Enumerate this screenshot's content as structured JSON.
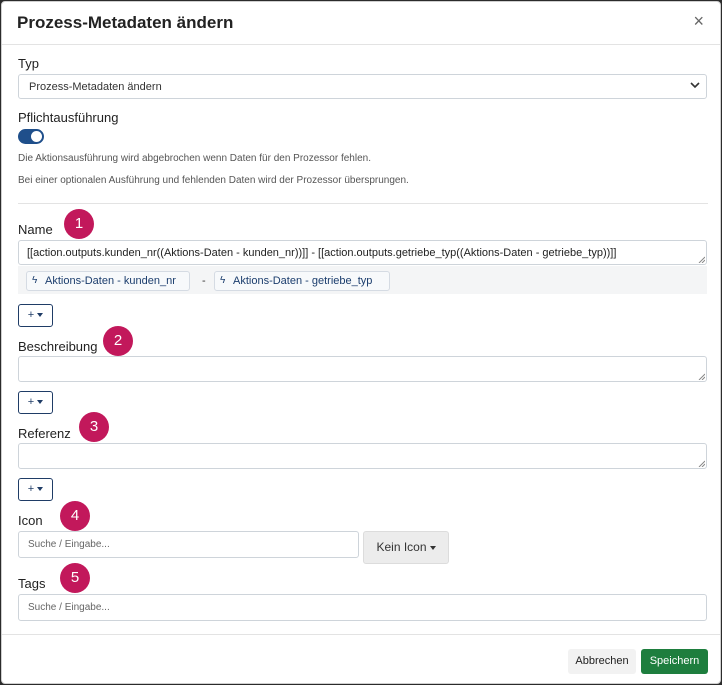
{
  "modal": {
    "title": "Prozess-Metadaten ändern",
    "close_glyph": "×"
  },
  "type_field": {
    "label": "Typ",
    "selected": "Prozess-Metadaten ändern",
    "icon": "chevron-down-icon"
  },
  "mandatory": {
    "label": "Pflichtausführung",
    "enabled": true,
    "hint1": "Die Aktionsausführung wird abgebrochen wenn Daten für den Prozessor fehlen.",
    "hint2": "Bei einer optionalen Ausführung und fehlenden Daten wird der Prozessor übersprungen."
  },
  "name_field": {
    "label": "Name",
    "badge": "1",
    "value": "[[action.outputs.kunden_nr((Aktions-Daten - kunden_nr))]] - [[action.outputs.getriebe_typ((Aktions-Daten - getriebe_typ))]]",
    "chips": [
      "Aktions-Daten - kunden_nr",
      "Aktions-Daten - getriebe_typ"
    ],
    "separator": "-",
    "chip_icon": "bolt-icon"
  },
  "description_field": {
    "label": "Beschreibung",
    "badge": "2",
    "value": ""
  },
  "reference_field": {
    "label": "Referenz",
    "badge": "3",
    "value": ""
  },
  "icon_field": {
    "label": "Icon",
    "badge": "4",
    "placeholder": "Suche / Eingabe...",
    "button_label": "Kein Icon"
  },
  "tags_field": {
    "label": "Tags",
    "badge": "5",
    "placeholder": "Suche / Eingabe..."
  },
  "add_button_label": "+",
  "footer": {
    "cancel_label": "Abbrechen",
    "save_label": "Speichern"
  },
  "colors": {
    "accent_badge": "#c2185b",
    "toggle": "#1f4f8b",
    "save": "#1e7e3e"
  }
}
